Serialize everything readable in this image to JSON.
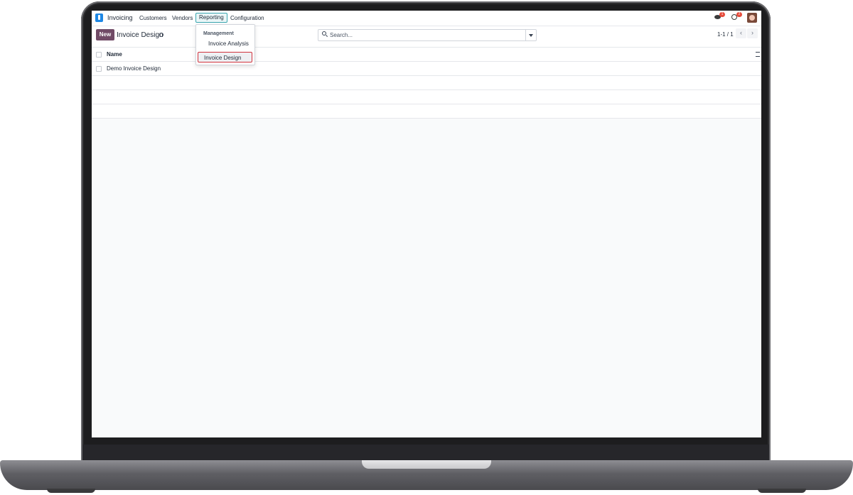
{
  "navbar": {
    "app_name": "Invoicing",
    "menu": [
      "Customers",
      "Vendors",
      "Reporting",
      "Configuration"
    ],
    "messages_count": "1",
    "activities_count": "2"
  },
  "reporting_menu": {
    "section": "Management",
    "items": [
      "Invoice Analysis",
      "Invoice Design"
    ],
    "highlighted_item": "Invoice Design",
    "highlight_color": "#d0323d"
  },
  "control_panel": {
    "new_label": "New",
    "title": "Invoice Design",
    "search_placeholder": "Search...",
    "pager": "1-1 / 1",
    "prev_label": "‹",
    "next_label": "›"
  },
  "list": {
    "column_header": "Name",
    "rows": [
      "Demo Invoice Design"
    ]
  },
  "colors": {
    "primary": "#714b67",
    "active_menu": "#3aa6b0"
  }
}
